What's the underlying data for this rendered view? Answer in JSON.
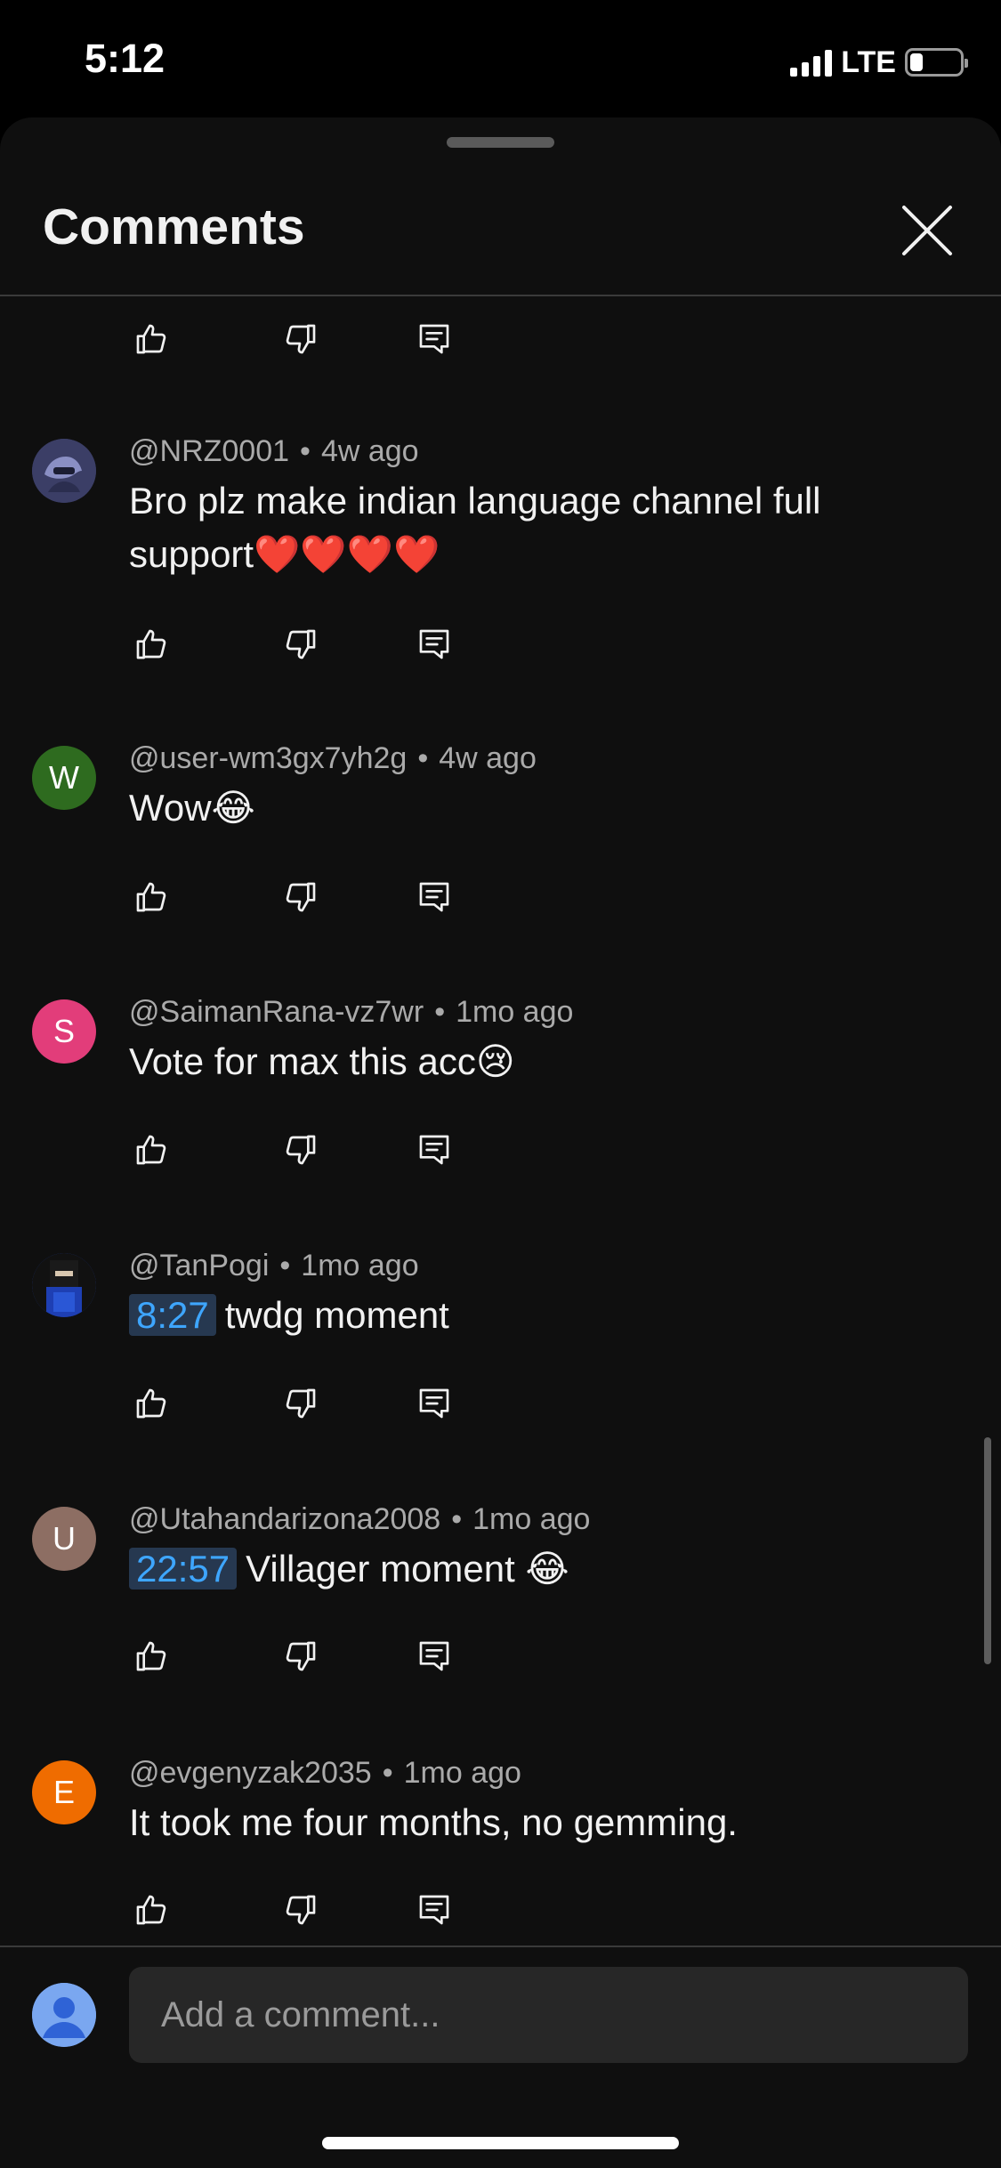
{
  "status_bar": {
    "time": "5:12",
    "network": "LTE",
    "battery_level": 0.25
  },
  "header": {
    "title": "Comments"
  },
  "comments": [
    {
      "author": "@NRZ0001",
      "age": "4w ago",
      "text": "Bro plz make indian language channel full support❤️❤️❤️❤️",
      "avatar": {
        "type": "image",
        "color": "#3b3e66"
      }
    },
    {
      "author": "@user-wm3gx7yh2g",
      "age": "4w ago",
      "text": "Wow😂",
      "avatar": {
        "type": "letter",
        "letter": "W",
        "color": "#2e6b1f"
      }
    },
    {
      "author": "@SaimanRana-vz7wr",
      "age": "1mo ago",
      "text": "Vote for max this acc😢",
      "avatar": {
        "type": "letter",
        "letter": "S",
        "color": "#e23d7a"
      }
    },
    {
      "author": "@TanPogi",
      "age": "1mo ago",
      "timestamp": "8:27",
      "text": "twdg moment",
      "avatar": {
        "type": "image",
        "color": "#1f3a8a"
      }
    },
    {
      "author": "@Utahandarizona2008",
      "age": "1mo ago",
      "timestamp": "22:57",
      "text": "Villager moment 😂",
      "avatar": {
        "type": "letter",
        "letter": "U",
        "color": "#8d6e63"
      }
    },
    {
      "author": "@evgenyzak2035",
      "age": "1mo ago",
      "text": "It took me four months, no gemming.",
      "avatar": {
        "type": "letter",
        "letter": "E",
        "color": "#ef6c00"
      }
    }
  ],
  "footer": {
    "input_placeholder": "Add a comment..."
  },
  "colors": {
    "background": "#0f0f0f",
    "timestamp_link": "#3ea6ff",
    "secondary_text": "#aaaaaa"
  }
}
